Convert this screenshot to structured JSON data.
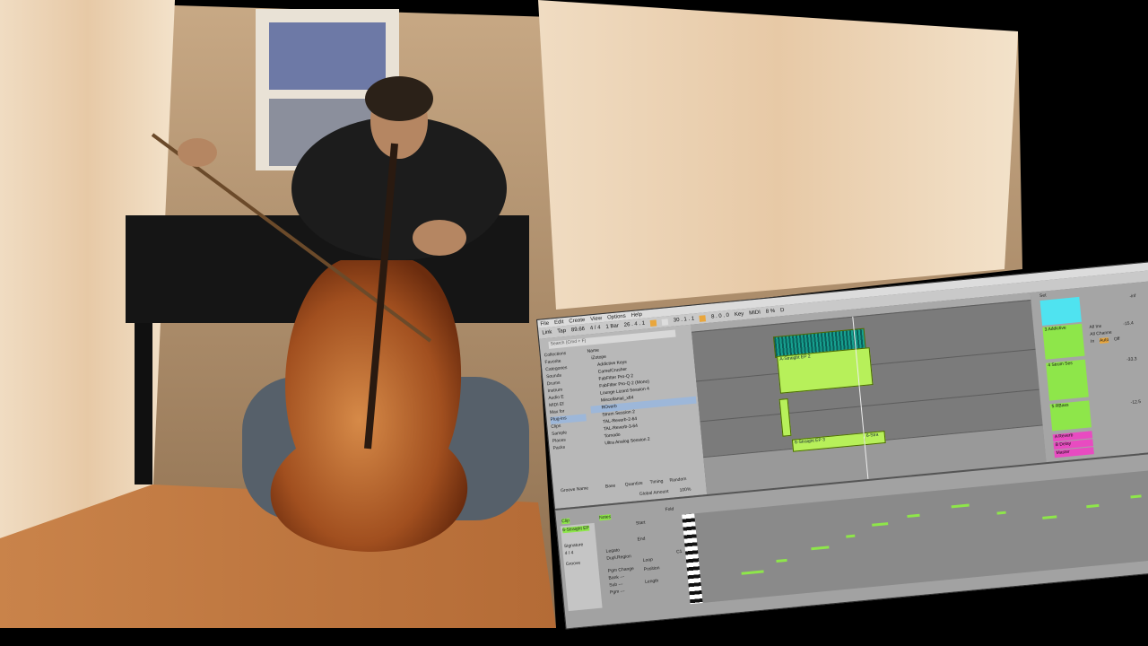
{
  "menu": [
    "File",
    "Edit",
    "Create",
    "View",
    "Options",
    "Help"
  ],
  "transport": {
    "link": "Link",
    "tap": "Tap",
    "tempo": "89.66",
    "sig": "4 / 4",
    "quant": "1 Bar",
    "position": "26 . 4 . 1",
    "loop_start": "30 . 1 . 1",
    "loop_len": "8 . 0 . 0",
    "key": "Key",
    "midi": "MIDI",
    "cpu": "8 %",
    "d": "D"
  },
  "browser": {
    "search_placeholder": "Search (Cmd + F)",
    "collections_title": "Collections",
    "collections": [
      "Favorite"
    ],
    "categories_title": "Categories",
    "categories": [
      "Sounds",
      "Drums",
      "Instrum",
      "Audio E",
      "MIDI Ef",
      "Max for",
      "Plug-ins",
      "Clips",
      "Sample"
    ],
    "places_title": "Places",
    "places": [
      "Packs"
    ],
    "header": "Name",
    "items": [
      "Addictive Keys",
      "CamelCrusher",
      "FabFilter Pro-Q 2",
      "FabFilter Pro-Q 2 (Mono)",
      "Lounge Lizard Session 4",
      "Miscellanial_x64",
      "ROverb",
      "Strum Session 2",
      "TAL-Reverb-2-64",
      "TAL-Reverb-3-64",
      "Tornado",
      "Ultra Analog Session 2"
    ],
    "root": "iZotope",
    "selected_index": 6
  },
  "groove": {
    "cols": [
      "Groove Name",
      "Base",
      "Quantize",
      "Timing",
      "Random"
    ],
    "amount_label": "Global Amount",
    "amount": "100%",
    "pool": "Groove Pool"
  },
  "arrangement": {
    "clips": [
      {
        "label": "A-Straight EP 2"
      },
      {
        "label": "6-Straight EP 3"
      },
      {
        "label": "6-Stra"
      }
    ]
  },
  "mixer": {
    "set": "Set",
    "tracks": [
      "3 Addictive",
      "4 Strum Ses",
      "5 RBass"
    ],
    "returns": [
      "A Reverb",
      "B Delay"
    ],
    "master": "Master",
    "inputs": [
      "All Ins",
      "All Channe"
    ],
    "monitor": [
      "In",
      "Auto",
      "Off"
    ],
    "vol_values": [
      "-inf",
      "-15.4",
      "-33.3",
      "-12.5"
    ]
  },
  "clip_detail": {
    "clip_label": "Clip",
    "clip_name": "6-Straight EP",
    "signature_label": "Signature",
    "signature": "4 / 4",
    "groove_label": "Groove",
    "notes_label": "Notes",
    "start_label": "Start",
    "end_label": "End",
    "loop_label": "Loop",
    "position_label": "Position",
    "length_label": "Length",
    "legato": "Legato",
    "dupl": "Dupl.Region",
    "pgm_change": "Pgm Change",
    "bank": "Bank ---",
    "sub": "Sub ---",
    "pgm": "Pgm ---",
    "fold": "Fold",
    "c1": "C1"
  },
  "colors": {
    "accent": "#8ee64a",
    "return_a": "#e84bc1",
    "master": "#e84bc1",
    "cyan": "#4fe3f0"
  }
}
